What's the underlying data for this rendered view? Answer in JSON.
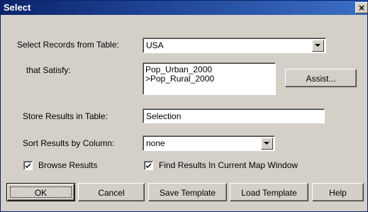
{
  "window": {
    "title": "Select",
    "close_label": "×"
  },
  "form": {
    "table_label": "Select Records from Table:",
    "table_value": "USA",
    "satisfy_label": "that Satisfy:",
    "condition_lines": [
      "Pop_Urban_2000",
      ">Pop_Rural_2000"
    ],
    "assist_label": "Assist...",
    "store_label": "Store Results in Table:",
    "store_value": "Selection",
    "sort_label": "Sort Results by Column:",
    "sort_value": "none",
    "browse_label": "Browse Results",
    "browse_checked": true,
    "find_label": "Find Results In Current Map Window",
    "find_checked": true
  },
  "buttons": {
    "ok": "OK",
    "cancel": "Cancel",
    "save_template": "Save Template",
    "load_template": "Load Template",
    "help": "Help"
  }
}
